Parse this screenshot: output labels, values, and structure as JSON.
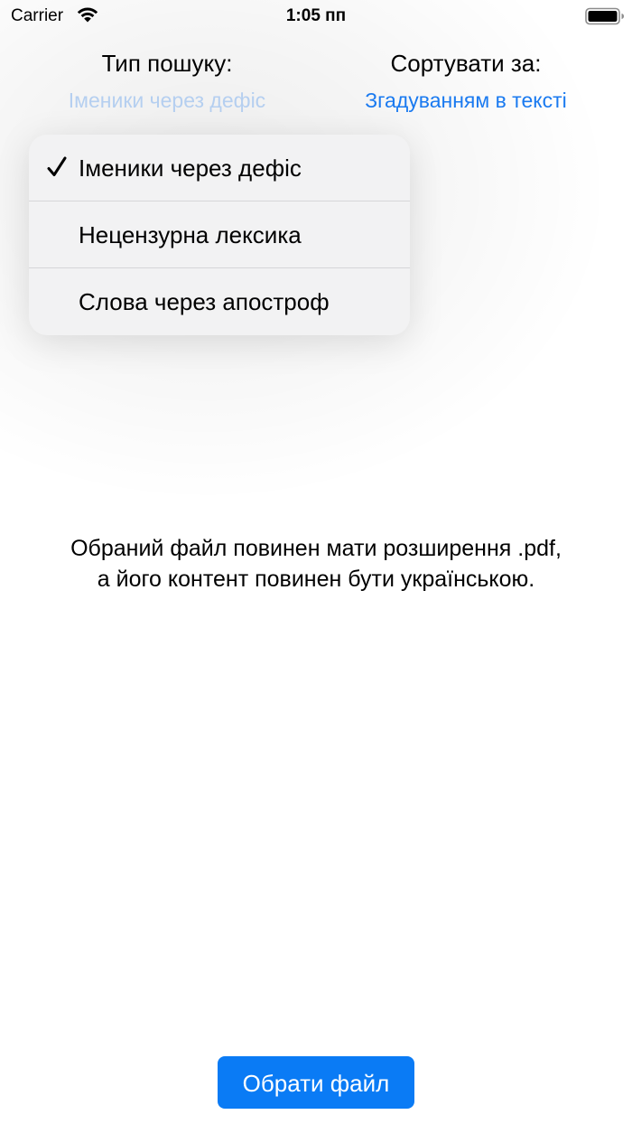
{
  "status_bar": {
    "carrier": "Carrier",
    "time": "1:05 пп"
  },
  "search_type": {
    "label": "Тип пошуку:",
    "value": "Іменики через дефіс"
  },
  "sort": {
    "label": "Сортувати за:",
    "value": "Згадуванням в тексті"
  },
  "menu": {
    "items": [
      {
        "label": "Іменики через дефіс",
        "checked": true
      },
      {
        "label": "Нецензурна лексика",
        "checked": false
      },
      {
        "label": "Слова через апостроф",
        "checked": false
      }
    ]
  },
  "info": {
    "line1": "Обраний файл повинен мати розширення .pdf,",
    "line2": "а його контент повинен бути українською."
  },
  "button": {
    "choose_file": "Обрати файл"
  },
  "colors": {
    "accent": "#0a7bf5",
    "disabled_value": "#b5cff0",
    "menu_bg": "#f2f2f3"
  },
  "icons": {
    "wifi": "wifi-icon",
    "battery": "battery-icon",
    "check": "checkmark-icon"
  }
}
